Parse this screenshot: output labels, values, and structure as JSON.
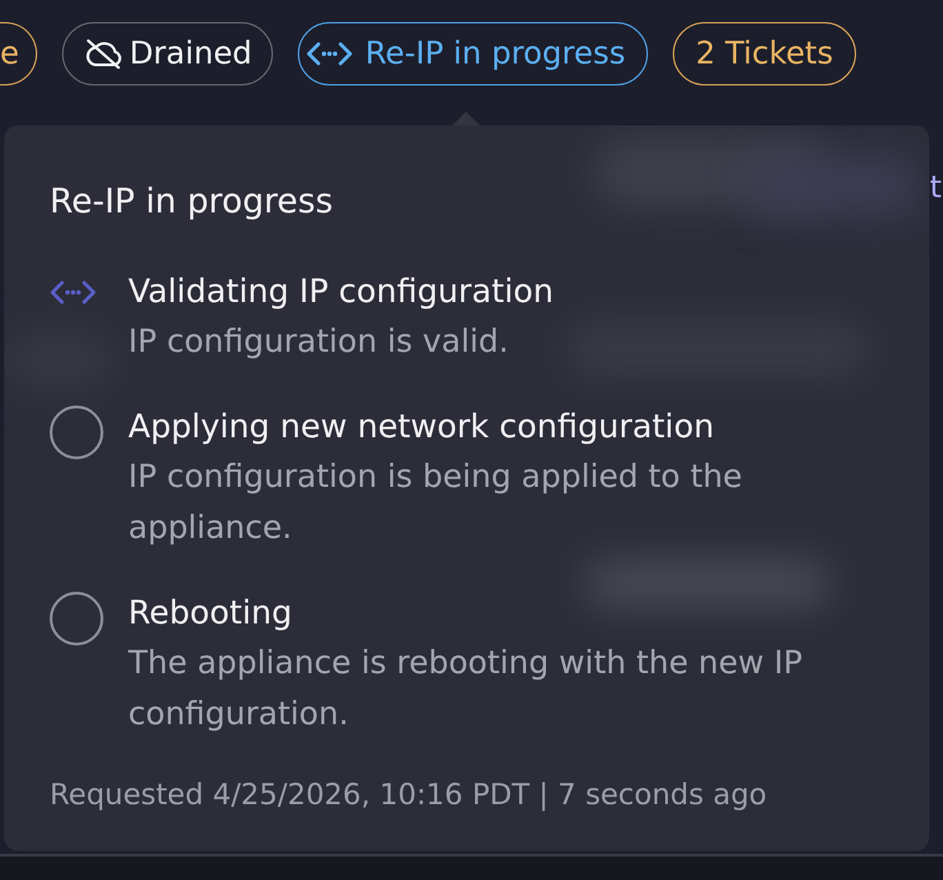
{
  "pills": [
    {
      "label": "e",
      "kind": "warning"
    },
    {
      "label": "Drained",
      "kind": "offline"
    },
    {
      "label": "Re-IP in progress",
      "kind": "reip"
    },
    {
      "label": "2 Tickets",
      "kind": "warning"
    }
  ],
  "background_row": {
    "end_text": "t"
  },
  "popover": {
    "title": "Re-IP in progress",
    "steps": [
      {
        "kind": "in_progress",
        "title": "Validating IP configuration",
        "description": "IP configuration is valid."
      },
      {
        "kind": "pending",
        "title": "Applying new network configuration",
        "description": "IP configuration is being applied to the appliance."
      },
      {
        "kind": "pending",
        "title": "Rebooting",
        "description": "The appliance is rebooting with the new IP configuration."
      }
    ],
    "footer": "Requested 4/25/2026, 10:16 PDT | 7 seconds ago"
  }
}
